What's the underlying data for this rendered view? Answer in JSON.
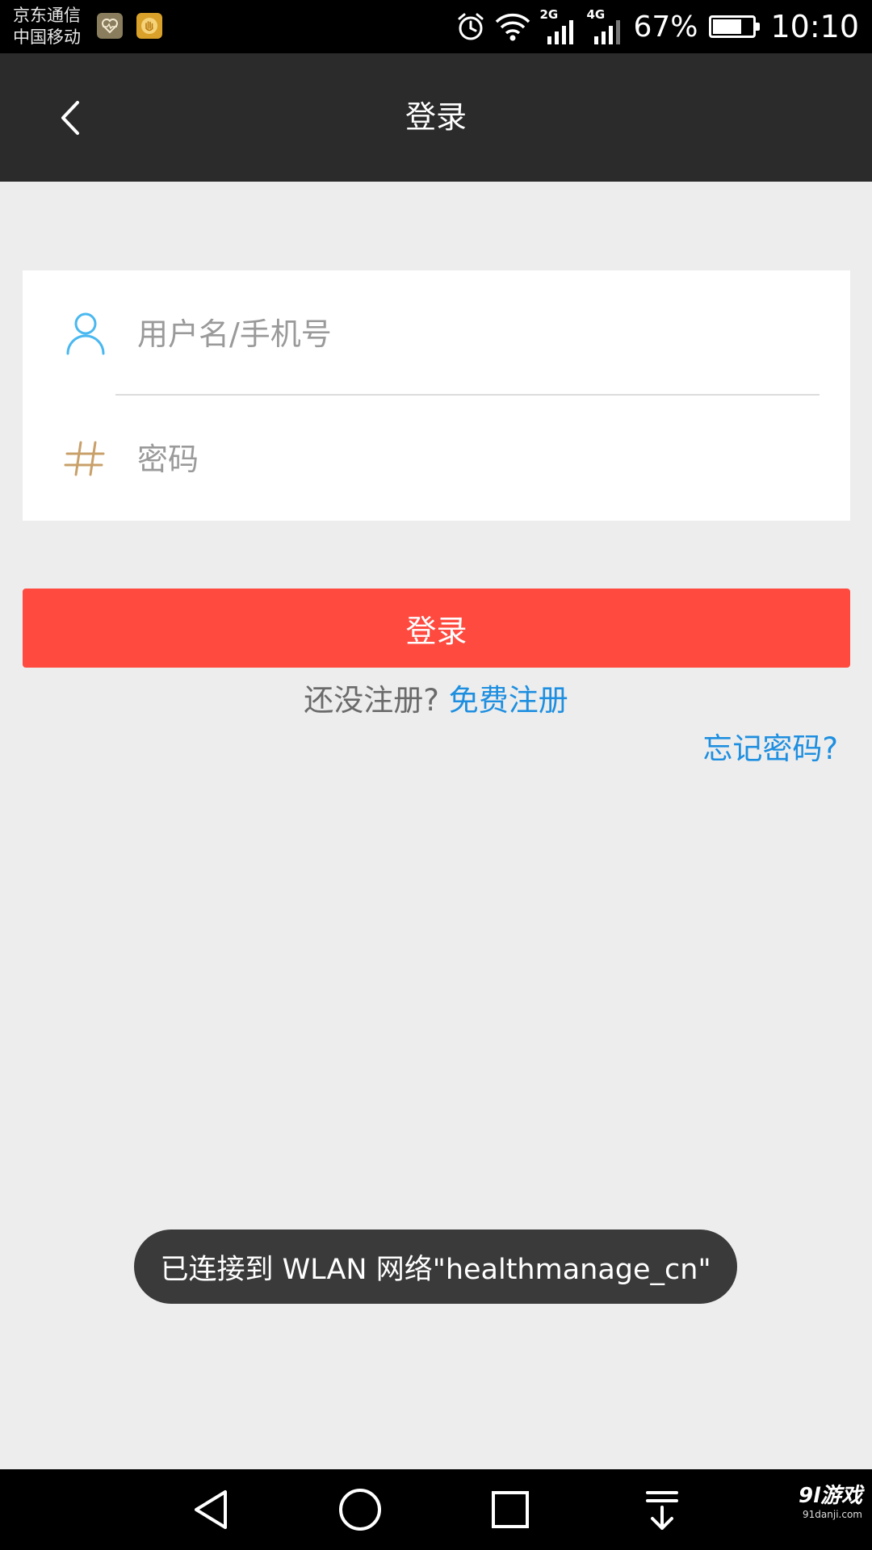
{
  "status_bar": {
    "carrier_1": "京东通信",
    "carrier_2": "中国移动",
    "notification_icons": [
      "health-app-icon",
      "hand-app-icon"
    ],
    "icons": [
      "alarm-icon",
      "wifi-icon",
      "signal-2g-icon",
      "signal-4g-icon"
    ],
    "sim1_network": "2G",
    "sim2_network": "4G",
    "battery_percent": "67%",
    "battery_level": 0.67,
    "time": "10:10"
  },
  "app_bar": {
    "title": "登录",
    "back_icon": "chevron-left-icon"
  },
  "form": {
    "username": {
      "icon": "user-icon",
      "placeholder": "用户名/手机号",
      "value": ""
    },
    "password": {
      "icon": "hash-icon",
      "placeholder": "密码",
      "value": ""
    }
  },
  "login_button": {
    "label": "登录"
  },
  "register": {
    "prompt": "还没注册?",
    "link": "免费注册"
  },
  "forgot_password": "忘记密码?",
  "toast": {
    "message": "已连接到 WLAN 网络\"healthmanage_cn\""
  },
  "nav_bar": {
    "buttons": [
      "back-triangle-icon",
      "home-circle-icon",
      "recent-square-icon",
      "pulldown-arrow-icon"
    ]
  },
  "watermark": {
    "main": "9l游戏",
    "sub": "91danji.com"
  },
  "colors": {
    "app_bar": "#2b2b2b",
    "page_background": "#ededed",
    "login_button": "#ff4a40",
    "link": "#1e8fe0",
    "user_icon": "#4ab8f0",
    "hash_icon": "#c9a06a"
  }
}
